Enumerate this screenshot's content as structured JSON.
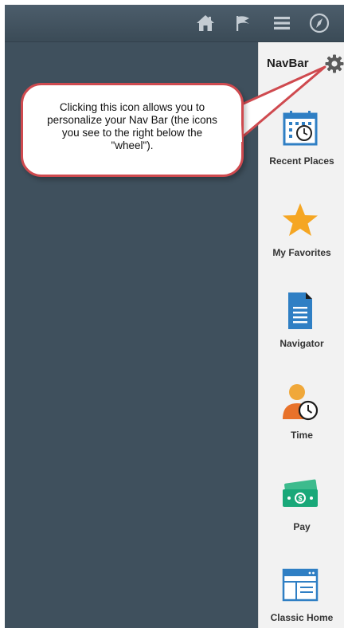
{
  "topbar": {
    "icons": [
      "home-icon",
      "flag-icon",
      "menu-icon",
      "compass-icon"
    ]
  },
  "navbar": {
    "title": "NavBar",
    "settings_icon": "gear-icon",
    "items": [
      {
        "label": "Recent Places",
        "icon": "calendar-clock-icon"
      },
      {
        "label": "My Favorites",
        "icon": "star-icon"
      },
      {
        "label": "Navigator",
        "icon": "document-icon"
      },
      {
        "label": "Time",
        "icon": "person-clock-icon"
      },
      {
        "label": "Pay",
        "icon": "money-icon"
      },
      {
        "label": "Classic Home",
        "icon": "window-icon"
      }
    ]
  },
  "callout": {
    "text": "Clicking this icon allows you to personalize your Nav Bar (the icons you see to the right below the \"wheel\")."
  },
  "colors": {
    "background": "#3f505d",
    "panel": "#f2f2f2",
    "accent_blue": "#2f7fc4",
    "star": "#f5a623",
    "callout_border": "#cf4a4f"
  }
}
